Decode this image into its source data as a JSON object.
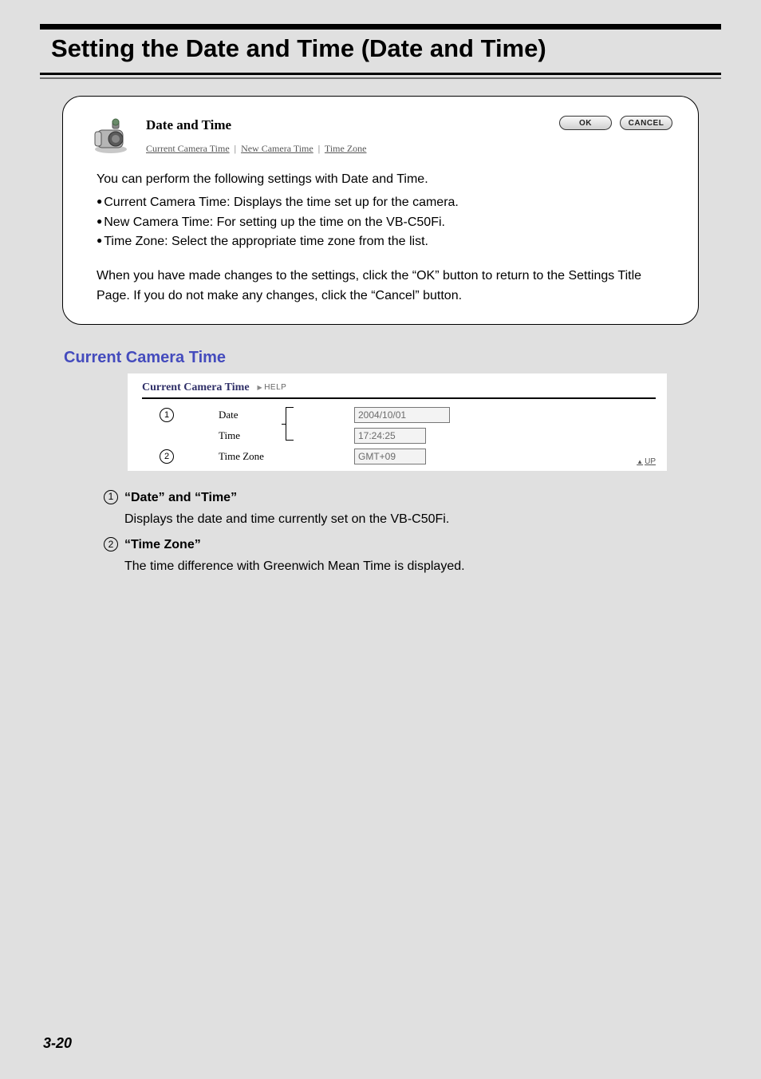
{
  "page_title": "Setting the Date and Time (Date and Time)",
  "panel": {
    "heading": "Date and Time",
    "tabs": [
      "Current Camera Time",
      "New Camera Time",
      "Time Zone"
    ],
    "buttons": {
      "ok": "OK",
      "cancel": "CANCEL"
    },
    "intro": "You can perform the following settings with Date and Time.",
    "bullets": [
      "Current Camera Time: Displays the time set up for the camera.",
      "New Camera Time: For setting up the time on the VB-C50Fi.",
      "Time Zone: Select the appropriate time zone from the list."
    ],
    "note": "When you have made changes to the settings, click the “OK” button to return to the Settings Title Page. If you do not make any changes, click the “Cancel” button."
  },
  "section_title": "Current Camera Time",
  "snapshot": {
    "title": "Current Camera Time",
    "help": "HELP",
    "rows": [
      {
        "callout": "1",
        "label": "Date",
        "value": "2004/10/01"
      },
      {
        "callout": "",
        "label": "Time",
        "value": "17:24:25"
      },
      {
        "callout": "2",
        "label": "Time Zone",
        "value": "GMT+09"
      }
    ],
    "up": "UP"
  },
  "defs": [
    {
      "num": "1",
      "label": "“Date” and “Time”",
      "desc": "Displays the date and time currently set on the VB-C50Fi."
    },
    {
      "num": "2",
      "label": "“Time Zone”",
      "desc": "The time difference with Greenwich Mean Time is displayed."
    }
  ],
  "page_number": "3-20"
}
